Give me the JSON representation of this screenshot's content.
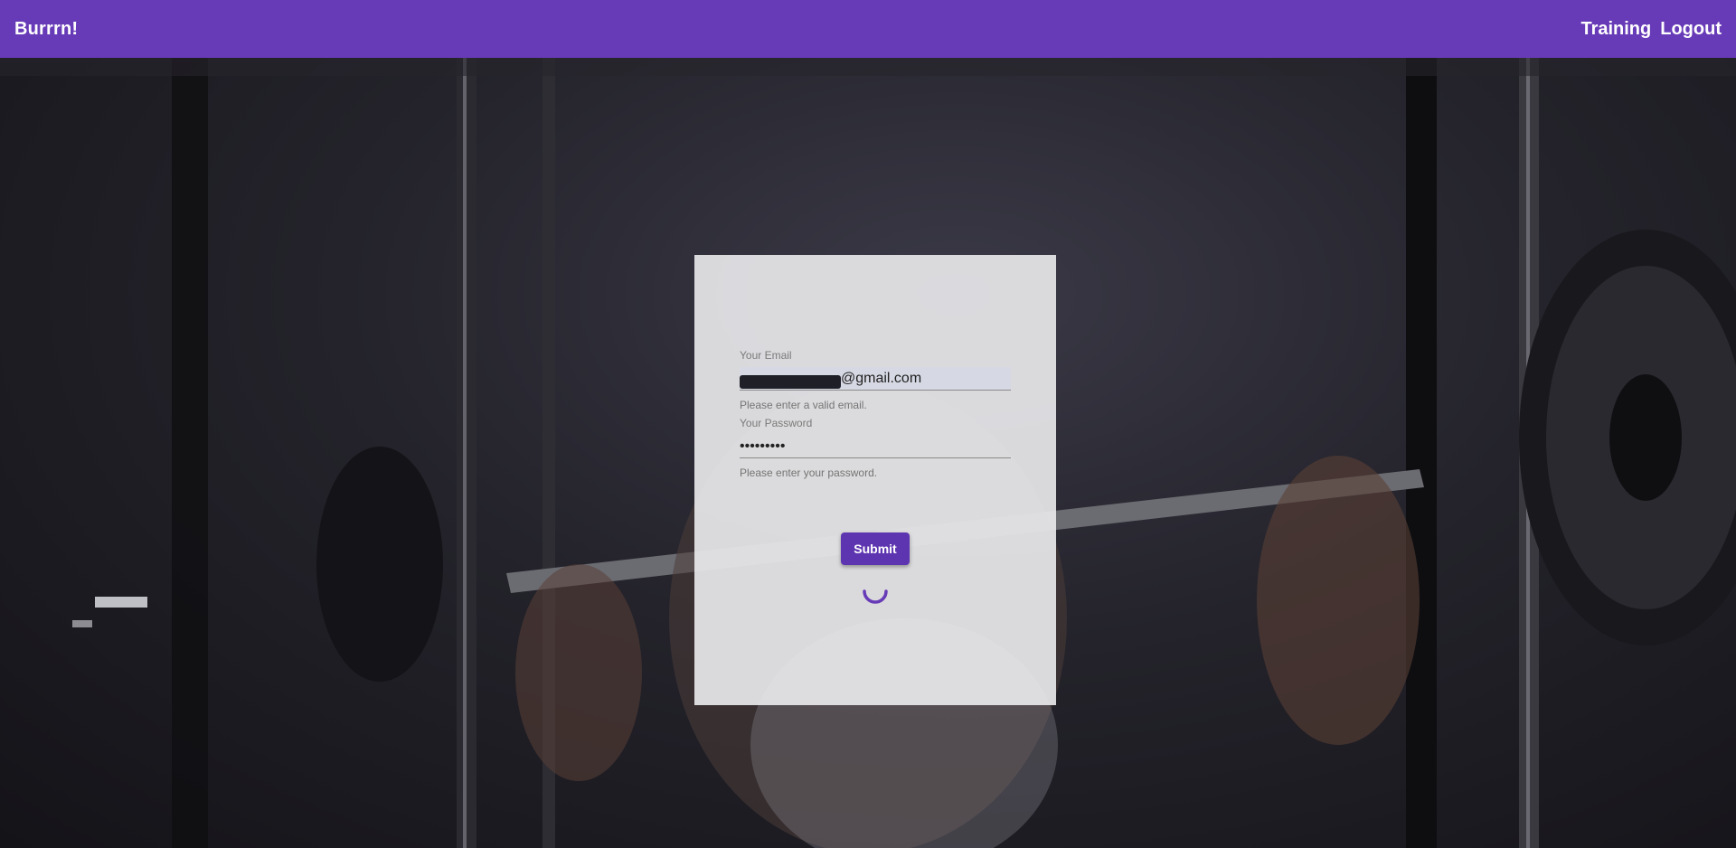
{
  "app": {
    "brand": "Burrrn!"
  },
  "nav": {
    "training": "Training",
    "logout": "Logout"
  },
  "login_form": {
    "email": {
      "label": "Your Email",
      "value": "@gmail.com",
      "hint": "Please enter a valid email."
    },
    "password": {
      "label": "Your Password",
      "value": "•••••••••",
      "hint": "Please enter your password."
    },
    "submit_label": "Submit"
  },
  "colors": {
    "toolbar": "#673ab7",
    "button": "#5e35b1",
    "spinner": "#673ab7"
  }
}
